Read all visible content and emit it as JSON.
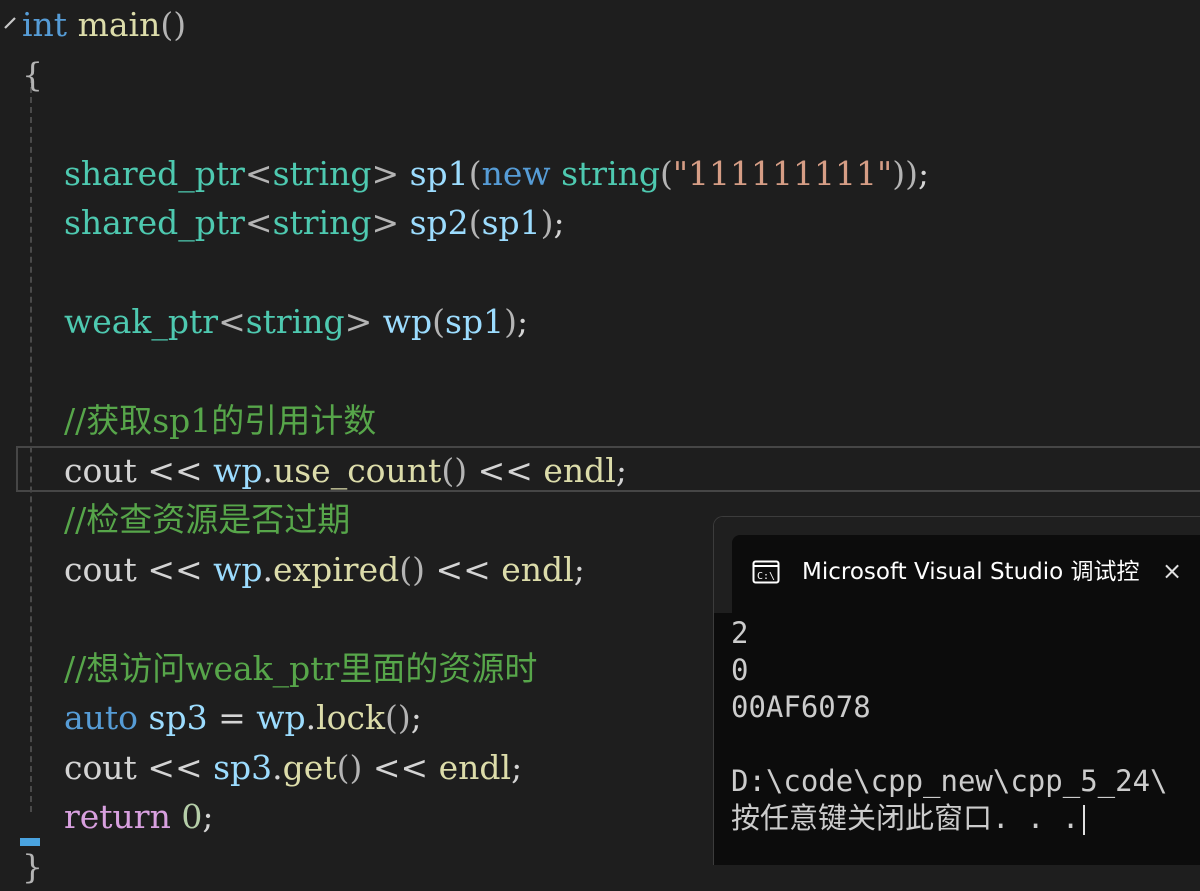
{
  "code_editor": {
    "lines": [
      [
        [
          "tok-kw",
          "int"
        ],
        [
          "tok-pl",
          " "
        ],
        [
          "tok-fn",
          "main"
        ],
        [
          "tok-br",
          "()"
        ]
      ],
      [
        [
          "tok-br",
          "{"
        ]
      ],
      [],
      [
        [
          "tok-pl",
          "    "
        ],
        [
          "tok-type",
          "shared_ptr"
        ],
        [
          "tok-br",
          "<"
        ],
        [
          "tok-type",
          "string"
        ],
        [
          "tok-br",
          "> "
        ],
        [
          "tok-var",
          "sp1"
        ],
        [
          "tok-br",
          "("
        ],
        [
          "tok-kw",
          "new"
        ],
        [
          "tok-pl",
          " "
        ],
        [
          "tok-type",
          "string"
        ],
        [
          "tok-br",
          "("
        ],
        [
          "tok-str",
          "\"111111111\""
        ],
        [
          "tok-br",
          "))"
        ],
        [
          "tok-pl",
          ";"
        ]
      ],
      [
        [
          "tok-pl",
          "    "
        ],
        [
          "tok-type",
          "shared_ptr"
        ],
        [
          "tok-br",
          "<"
        ],
        [
          "tok-type",
          "string"
        ],
        [
          "tok-br",
          "> "
        ],
        [
          "tok-var",
          "sp2"
        ],
        [
          "tok-br",
          "("
        ],
        [
          "tok-var",
          "sp1"
        ],
        [
          "tok-br",
          ")"
        ],
        [
          "tok-pl",
          ";"
        ]
      ],
      [],
      [
        [
          "tok-pl",
          "    "
        ],
        [
          "tok-type",
          "weak_ptr"
        ],
        [
          "tok-br",
          "<"
        ],
        [
          "tok-type",
          "string"
        ],
        [
          "tok-br",
          "> "
        ],
        [
          "tok-var",
          "wp"
        ],
        [
          "tok-br",
          "("
        ],
        [
          "tok-var",
          "sp1"
        ],
        [
          "tok-br",
          ")"
        ],
        [
          "tok-pl",
          ";"
        ]
      ],
      [],
      [
        [
          "tok-pl",
          "    "
        ],
        [
          "tok-cmt",
          "//获取sp1的引用计数"
        ]
      ],
      [
        [
          "tok-pl",
          "    cout << "
        ],
        [
          "tok-var",
          "wp"
        ],
        [
          "tok-pl",
          "."
        ],
        [
          "tok-fn",
          "use_count"
        ],
        [
          "tok-br",
          "()"
        ],
        [
          "tok-pl",
          " << "
        ],
        [
          "tok-fn",
          "endl"
        ],
        [
          "tok-pl",
          ";"
        ]
      ],
      [
        [
          "tok-pl",
          "    "
        ],
        [
          "tok-cmt",
          "//检查资源是否过期"
        ]
      ],
      [
        [
          "tok-pl",
          "    cout << "
        ],
        [
          "tok-var",
          "wp"
        ],
        [
          "tok-pl",
          "."
        ],
        [
          "tok-fn",
          "expired"
        ],
        [
          "tok-br",
          "()"
        ],
        [
          "tok-pl",
          " << "
        ],
        [
          "tok-fn",
          "endl"
        ],
        [
          "tok-pl",
          ";"
        ]
      ],
      [],
      [
        [
          "tok-pl",
          "    "
        ],
        [
          "tok-cmt",
          "//想访问weak_ptr里面的资源时"
        ]
      ],
      [
        [
          "tok-pl",
          "    "
        ],
        [
          "tok-kw",
          "auto"
        ],
        [
          "tok-pl",
          " "
        ],
        [
          "tok-var",
          "sp3"
        ],
        [
          "tok-pl",
          " = "
        ],
        [
          "tok-var",
          "wp"
        ],
        [
          "tok-pl",
          "."
        ],
        [
          "tok-fn",
          "lock"
        ],
        [
          "tok-br",
          "()"
        ],
        [
          "tok-pl",
          ";"
        ]
      ],
      [
        [
          "tok-pl",
          "    cout << "
        ],
        [
          "tok-var",
          "sp3"
        ],
        [
          "tok-pl",
          "."
        ],
        [
          "tok-fn",
          "get"
        ],
        [
          "tok-br",
          "()"
        ],
        [
          "tok-pl",
          " << "
        ],
        [
          "tok-fn",
          "endl"
        ],
        [
          "tok-pl",
          ";"
        ]
      ],
      [
        [
          "tok-pl",
          "    "
        ],
        [
          "tok-ctl",
          "return"
        ],
        [
          "tok-pl",
          " "
        ],
        [
          "tok-num",
          "0"
        ],
        [
          "tok-pl",
          ";"
        ]
      ],
      [
        [
          "tok-br",
          "}"
        ]
      ]
    ]
  },
  "console": {
    "icon": "console-app-icon",
    "title": "Microsoft Visual Studio 调试控",
    "close_icon": "×",
    "output": [
      "2",
      "0",
      "00AF6078",
      "",
      "D:\\code\\cpp_new\\cpp_5_24\\",
      "按任意键关闭此窗口. . ."
    ]
  }
}
